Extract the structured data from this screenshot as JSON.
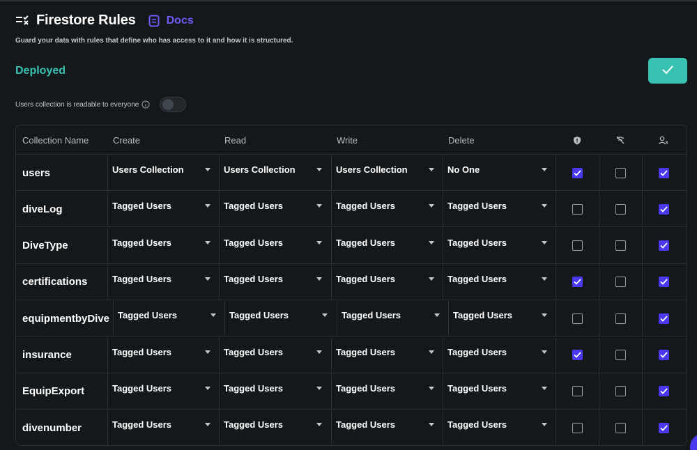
{
  "header": {
    "title": "Firestore Rules",
    "docs_label": "Docs",
    "subtitle": "Guard your data with rules that define who has access to it and how it is structured.",
    "status": "Deployed",
    "toggle_label": "Users collection is readable to everyone",
    "toggle_on": false
  },
  "colors": {
    "accent_teal": "#39c2b2",
    "accent_purple": "#4b39ef",
    "docs_purple": "#6f5cf6",
    "background": "#14181b"
  },
  "table": {
    "columns": [
      "Collection Name",
      "Create",
      "Read",
      "Write",
      "Delete"
    ],
    "icon_columns": [
      "shield-icon",
      "no-signal-icon",
      "user-x-icon"
    ],
    "rows": [
      {
        "name": "users",
        "create": "Users Collection",
        "read": "Users Collection",
        "write": "Users Collection",
        "delete": "No One",
        "c1": true,
        "c2": false,
        "c3": true
      },
      {
        "name": "diveLog",
        "create": "Tagged Users",
        "read": "Tagged Users",
        "write": "Tagged Users",
        "delete": "Tagged Users",
        "c1": false,
        "c2": false,
        "c3": true
      },
      {
        "name": "DiveType",
        "create": "Tagged Users",
        "read": "Tagged Users",
        "write": "Tagged Users",
        "delete": "Tagged Users",
        "c1": false,
        "c2": false,
        "c3": true
      },
      {
        "name": "certifications",
        "create": "Tagged Users",
        "read": "Tagged Users",
        "write": "Tagged Users",
        "delete": "Tagged Users",
        "c1": true,
        "c2": false,
        "c3": true
      },
      {
        "name": "equipmentbyDive",
        "create": "Tagged Users",
        "read": "Tagged Users",
        "write": "Tagged Users",
        "delete": "Tagged Users",
        "c1": false,
        "c2": false,
        "c3": true
      },
      {
        "name": "insurance",
        "create": "Tagged Users",
        "read": "Tagged Users",
        "write": "Tagged Users",
        "delete": "Tagged Users",
        "c1": true,
        "c2": false,
        "c3": true
      },
      {
        "name": "EquipExport",
        "create": "Tagged Users",
        "read": "Tagged Users",
        "write": "Tagged Users",
        "delete": "Tagged Users",
        "c1": false,
        "c2": false,
        "c3": true
      },
      {
        "name": "divenumber",
        "create": "Tagged Users",
        "read": "Tagged Users",
        "write": "Tagged Users",
        "delete": "Tagged Users",
        "c1": false,
        "c2": false,
        "c3": true
      }
    ]
  }
}
